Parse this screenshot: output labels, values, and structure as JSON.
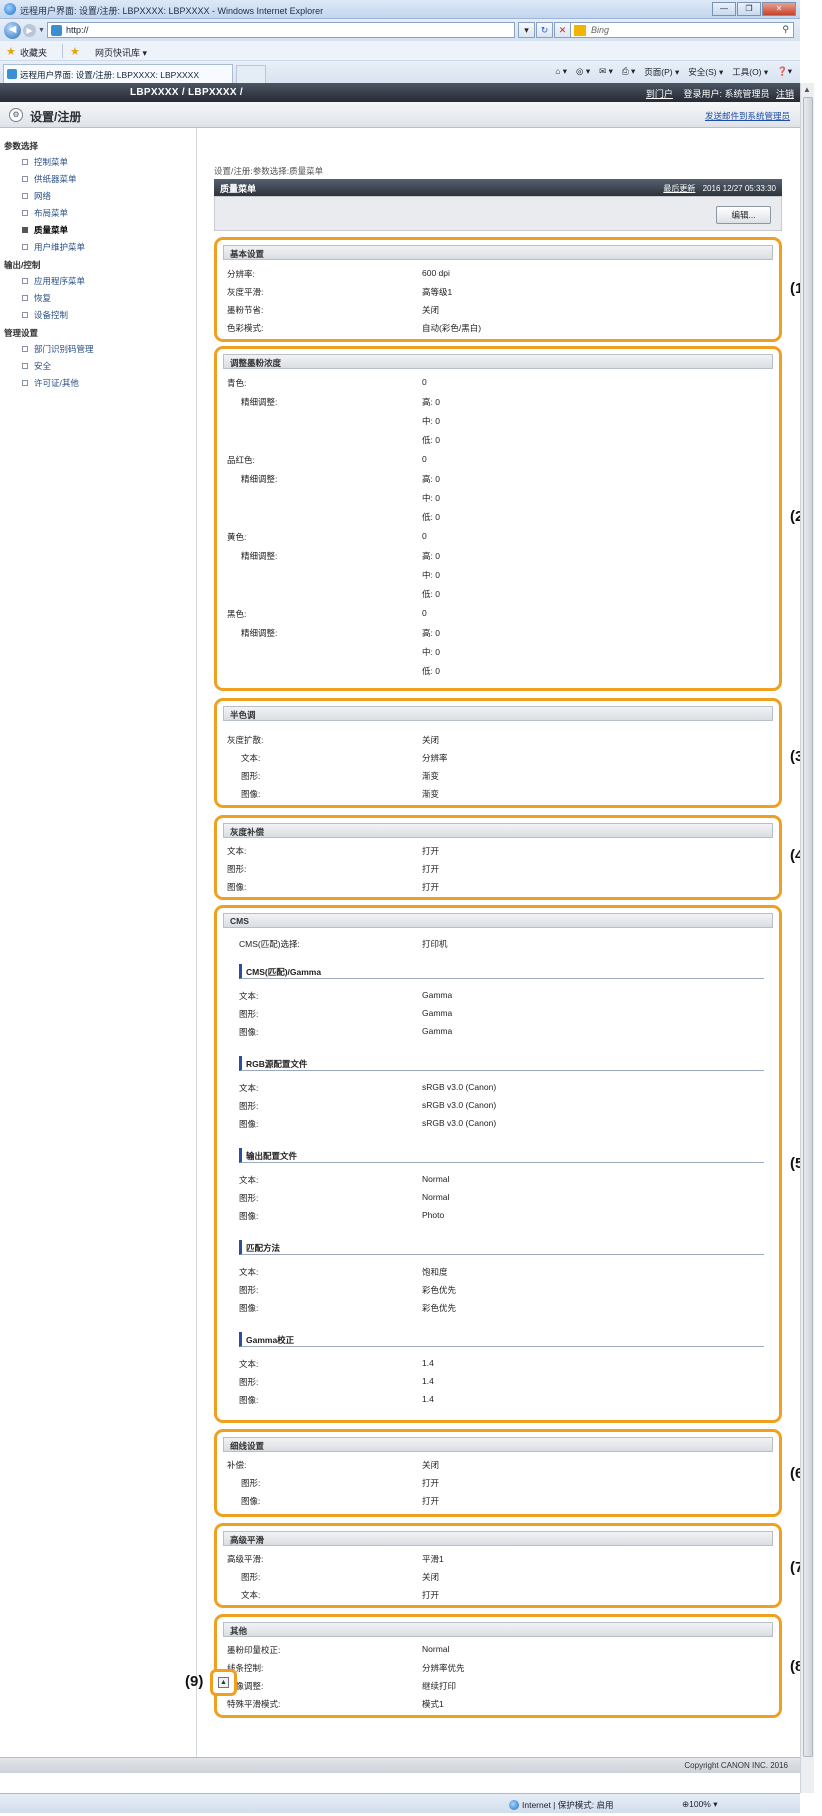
{
  "browser": {
    "window_title": "远程用户界面: 设置/注册: LBPXXXX: LBPXXXX - Windows Internet Explorer",
    "address": "http://",
    "search_placeholder": "Bing",
    "favorites_label": "收藏夹",
    "web_slices": "网页快讯库 ▾",
    "tab_title": "远程用户界面: 设置/注册: LBPXXXX: LBPXXXX",
    "cmd_page": "页面(P) ▾",
    "cmd_safety": "安全(S) ▾",
    "cmd_tools": "工具(O) ▾",
    "cmd_help": "❓▾",
    "status_zone": "Internet | 保护模式: 启用",
    "status_zoom": "⊕100% ▾"
  },
  "header": {
    "product": "LBPXXXX / LBPXXXX /",
    "portal": "到门户",
    "login_user": "登录用户: 系统管理员",
    "logout": "注销"
  },
  "section": {
    "title": "设置/注册",
    "mail_link": "发送邮件到系统管理员"
  },
  "sidebar": {
    "cat1": "参数选择",
    "cat2": "输出/控制",
    "cat3": "管理设置",
    "items": [
      {
        "label": "控制菜单"
      },
      {
        "label": "供纸器菜单"
      },
      {
        "label": "网络"
      },
      {
        "label": "布局菜单"
      },
      {
        "label": "质量菜单"
      },
      {
        "label": "用户维护菜单"
      },
      {
        "label": "应用程序菜单"
      },
      {
        "label": "恢复"
      },
      {
        "label": "设备控制"
      },
      {
        "label": "部门识别码管理"
      },
      {
        "label": "安全"
      },
      {
        "label": "许可证/其他"
      }
    ]
  },
  "main": {
    "breadcrumb": "设置/注册:参数选择:质量菜单",
    "panel_title": "质量菜单",
    "refresh": "最后更新",
    "timestamp": "2016 12/27 05:33:30",
    "edit_button": "编辑..."
  },
  "groups": {
    "basic": {
      "title": "基本设置",
      "rows": [
        {
          "k": "分辨率:",
          "v": "600 dpi"
        },
        {
          "k": "灰度平滑:",
          "v": "高等级1"
        },
        {
          "k": "墨粉节省:",
          "v": "关闭"
        },
        {
          "k": "色彩模式:",
          "v": "自动(彩色/黑白)"
        }
      ]
    },
    "density": {
      "title": "调整墨粉浓度",
      "colors": [
        {
          "name": "青色:",
          "v": "0",
          "fine": "精细调整:",
          "high": "高: 0",
          "mid": "中: 0",
          "low": "低: 0"
        },
        {
          "name": "品红色:",
          "v": "0",
          "fine": "精细调整:",
          "high": "高: 0",
          "mid": "中: 0",
          "low": "低: 0"
        },
        {
          "name": "黄色:",
          "v": "0",
          "fine": "精细调整:",
          "high": "高: 0",
          "mid": "中: 0",
          "low": "低: 0"
        },
        {
          "name": "黑色:",
          "v": "0",
          "fine": "精细调整:",
          "high": "高: 0",
          "mid": "中: 0",
          "low": "低: 0"
        }
      ]
    },
    "halftone": {
      "title": "半色调",
      "rows": [
        {
          "k": "灰度扩散:",
          "v": "关闭"
        },
        {
          "k": "文本:",
          "v": "分辨率"
        },
        {
          "k": "图形:",
          "v": "渐变"
        },
        {
          "k": "图像:",
          "v": "渐变"
        }
      ]
    },
    "edge": {
      "title": "灰度补偿",
      "rows": [
        {
          "k": "文本:",
          "v": "打开"
        },
        {
          "k": "图形:",
          "v": "打开"
        },
        {
          "k": "图像:",
          "v": "打开"
        }
      ]
    },
    "cms": {
      "title": "CMS",
      "select_k": "CMS(匹配)选择:",
      "select_v": "打印机",
      "sub1": "CMS(匹配)/Gamma",
      "sub1_rows": [
        {
          "k": "文本:",
          "v": "Gamma"
        },
        {
          "k": "图形:",
          "v": "Gamma"
        },
        {
          "k": "图像:",
          "v": "Gamma"
        }
      ],
      "sub2": "RGB源配置文件",
      "sub2_rows": [
        {
          "k": "文本:",
          "v": "sRGB v3.0 (Canon)"
        },
        {
          "k": "图形:",
          "v": "sRGB v3.0 (Canon)"
        },
        {
          "k": "图像:",
          "v": "sRGB v3.0 (Canon)"
        }
      ],
      "sub3": "输出配置文件",
      "sub3_rows": [
        {
          "k": "文本:",
          "v": "Normal"
        },
        {
          "k": "图形:",
          "v": "Normal"
        },
        {
          "k": "图像:",
          "v": "Photo"
        }
      ],
      "sub4": "匹配方法",
      "sub4_rows": [
        {
          "k": "文本:",
          "v": "饱和度"
        },
        {
          "k": "图形:",
          "v": "彩色优先"
        },
        {
          "k": "图像:",
          "v": "彩色优先"
        }
      ],
      "sub5": "Gamma校正",
      "sub5_rows": [
        {
          "k": "文本:",
          "v": "1.4"
        },
        {
          "k": "图形:",
          "v": "1.4"
        },
        {
          "k": "图像:",
          "v": "1.4"
        }
      ]
    },
    "trap": {
      "title": "细线设置",
      "rows": [
        {
          "k": "补偿:",
          "v": "关闭"
        },
        {
          "k": "图形:",
          "v": "打开"
        },
        {
          "k": "图像:",
          "v": "打开"
        }
      ]
    },
    "smooth": {
      "title": "高级平滑",
      "rows": [
        {
          "k": "高级平滑:",
          "v": "平滑1"
        },
        {
          "k": "图形:",
          "v": "关闭"
        },
        {
          "k": "文本:",
          "v": "打开"
        }
      ]
    },
    "other": {
      "title": "其他",
      "rows": [
        {
          "k": "墨粉印量校正:",
          "v": "Normal"
        },
        {
          "k": "线条控制:",
          "v": "分辨率优先"
        },
        {
          "k": "图像调整:",
          "v": "继续打印"
        },
        {
          "k": "特殊平滑模式:",
          "v": "模式1"
        }
      ]
    }
  },
  "callouts": [
    "(1",
    "(2",
    "(3",
    "(4",
    "(5",
    "(6",
    "(7",
    "(8",
    "(9)"
  ],
  "footer": {
    "copyright": "Copyright CANON INC. 2016"
  }
}
